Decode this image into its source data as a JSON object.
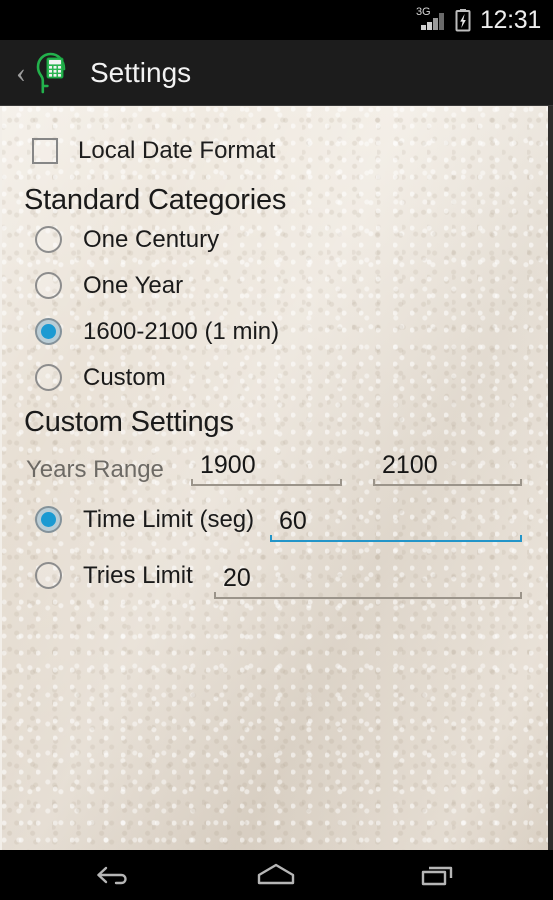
{
  "status_bar": {
    "network_label": "3G",
    "signal_icon": "signal-bars-icon",
    "battery_icon": "battery-charging-icon",
    "clock": "12:31"
  },
  "action_bar": {
    "back_icon": "back-chevron-icon",
    "app_icon": "brain-calculator-icon",
    "title": "Settings"
  },
  "content": {
    "local_date_format": {
      "label": "Local Date Format",
      "checked": false
    },
    "standard_categories": {
      "heading": "Standard Categories",
      "options": [
        {
          "label": "One Century",
          "selected": false
        },
        {
          "label": "One Year",
          "selected": false
        },
        {
          "label": "1600-2100 (1 min)",
          "selected": true
        },
        {
          "label": "Custom",
          "selected": false
        }
      ]
    },
    "custom_settings": {
      "heading": "Custom Settings",
      "years_range": {
        "label": "Years Range",
        "from_value": "1900",
        "to_value": "2100"
      },
      "time_limit": {
        "label": "Time Limit (seg)",
        "value": "60",
        "selected": true,
        "focused": true
      },
      "tries_limit": {
        "label": "Tries Limit",
        "value": "20",
        "selected": false,
        "focused": false
      }
    }
  },
  "nav_bar": {
    "back_icon": "nav-back-icon",
    "home_icon": "nav-home-icon",
    "recents_icon": "nav-recents-icon"
  },
  "colors": {
    "accent_blue": "#1b9ad2",
    "focus_underline": "#2395c9",
    "app_icon_green": "#23b14c",
    "paper_bg": "#e9e1d7",
    "action_bar_bg": "#1c1c1c"
  }
}
